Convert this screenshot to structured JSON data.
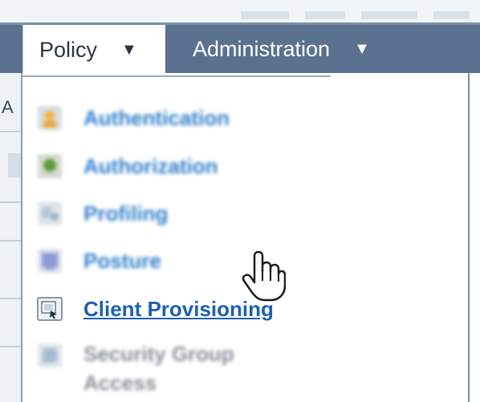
{
  "nav": {
    "tabs": [
      {
        "label": "Policy",
        "arrow": "▼",
        "active": true
      },
      {
        "label": "Administration",
        "arrow": "▼",
        "active": false
      }
    ]
  },
  "left_fragment": {
    "letter": "A"
  },
  "menu": {
    "items": [
      {
        "label": "Authentication",
        "icon": "authentication-icon",
        "blurred": true
      },
      {
        "label": "Authorization",
        "icon": "authorization-icon",
        "blurred": true
      },
      {
        "label": "Profiling",
        "icon": "profiling-icon",
        "blurred": true
      },
      {
        "label": "Posture",
        "icon": "posture-icon",
        "blurred": true
      },
      {
        "label": "Client Provisioning",
        "icon": "client-provisioning-icon",
        "blurred": false,
        "hovered": true
      },
      {
        "label": "Security Group Access",
        "icon": "security-group-access-icon",
        "blurred": true
      }
    ]
  },
  "colors": {
    "navbar": "#5a718f",
    "link": "#2f7ecb",
    "active_link": "#1f5fb3"
  }
}
